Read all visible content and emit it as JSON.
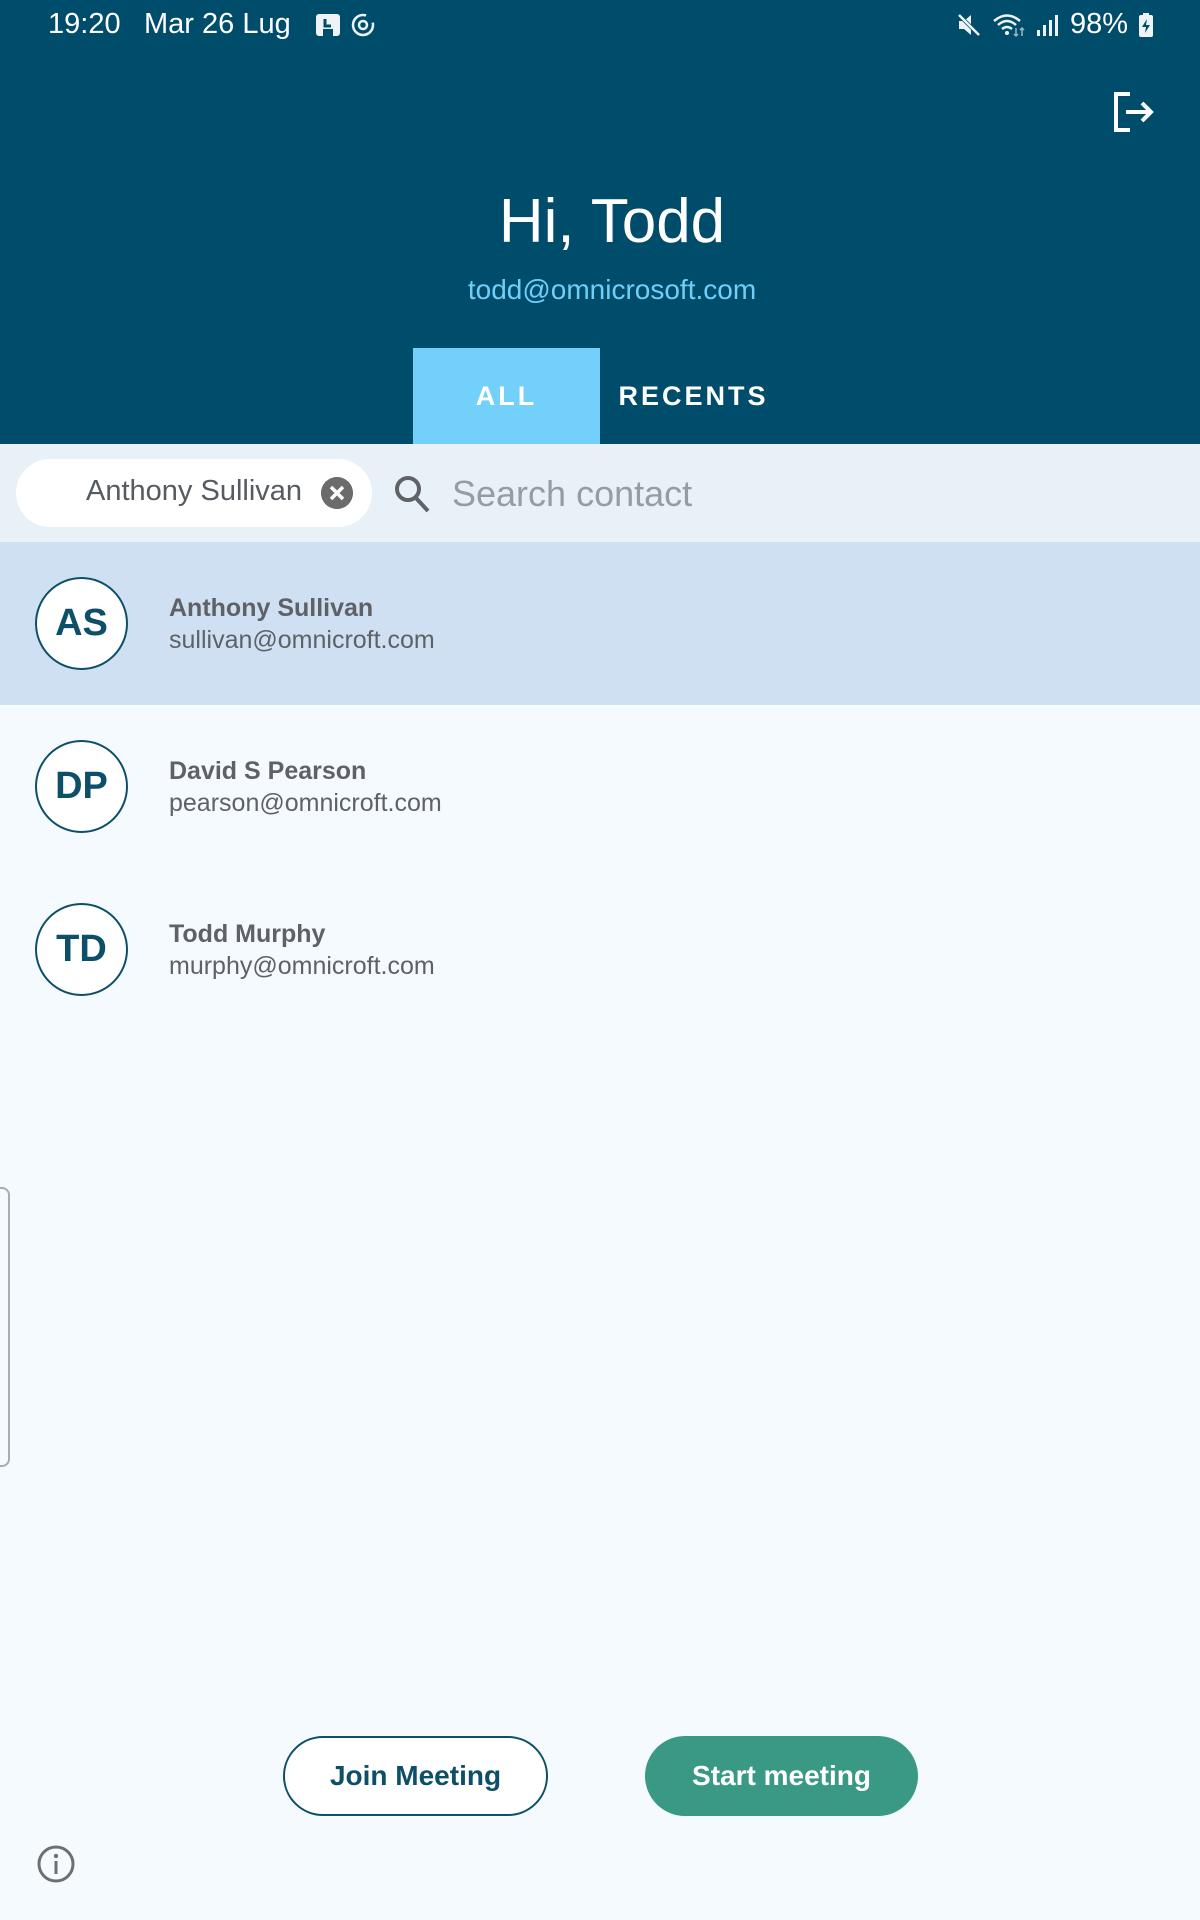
{
  "status_bar": {
    "time": "19:20",
    "date": "Mar 26 Lug",
    "left_icons": [
      "calendar-save-icon",
      "sync-icon"
    ],
    "right_icons": [
      "mute-icon",
      "wifi-icon",
      "signal-icon",
      "battery-charging-icon"
    ],
    "battery": "98%"
  },
  "header": {
    "greeting": "Hi, Todd",
    "email": "todd@omnicrosoft.com",
    "logout_icon": "logout-icon",
    "tabs": [
      {
        "label": "ALL",
        "active": true
      },
      {
        "label": "RECENTS",
        "active": false
      }
    ]
  },
  "search": {
    "selected_chip": "Anthony Sullivan",
    "placeholder": "Search contact",
    "value": ""
  },
  "contacts": [
    {
      "initials": "AS",
      "name": "Anthony Sullivan",
      "email": "sullivan@omnicroft.com",
      "selected": true
    },
    {
      "initials": "DP",
      "name": "David S Pearson",
      "email": "pearson@omnicroft.com",
      "selected": false
    },
    {
      "initials": "TD",
      "name": "Todd Murphy",
      "email": "murphy@omnicroft.com",
      "selected": false
    }
  ],
  "actions": {
    "join_label": "Join Meeting",
    "start_label": "Start meeting"
  },
  "colors": {
    "header_bg": "#004d6b",
    "tab_active": "#73d0fb",
    "accent_email": "#6fcff9",
    "selected_row": "#cfe0f2",
    "start_button": "#3a9985",
    "primary_dark": "#0d4f69"
  }
}
